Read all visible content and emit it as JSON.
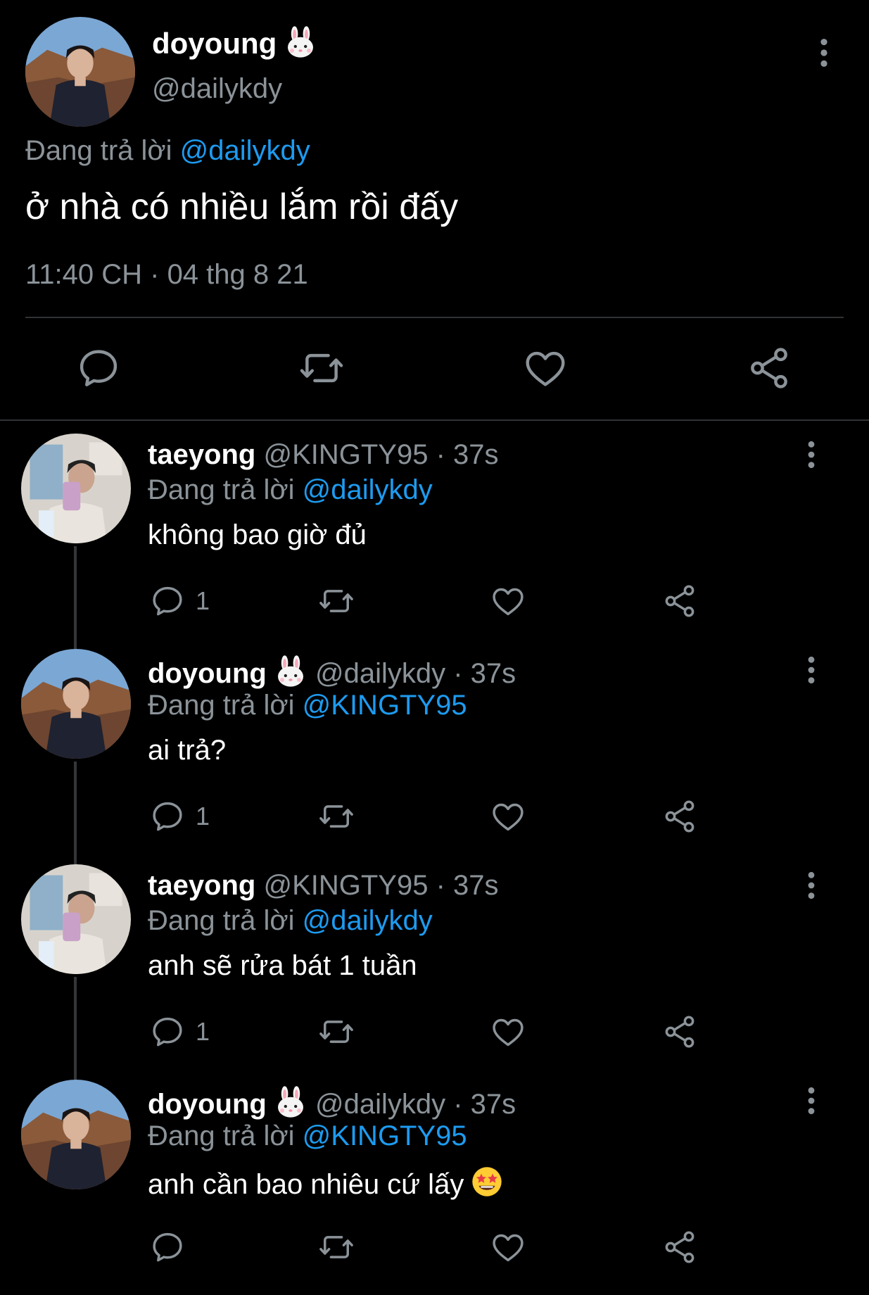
{
  "main_tweet": {
    "name": "doyoung",
    "handle": "@dailykdy",
    "replying_prefix": "Đang trả lời ",
    "replying_to": "@dailykdy",
    "text": "ở nhà có nhiều lắm rồi đấy",
    "timestamp": "11:40 CH · 04 thg 8 21"
  },
  "replies": [
    {
      "name": "taeyong",
      "handle_time": " @KINGTY95 · 37s",
      "replying_prefix": "Đang trả lời ",
      "replying_to": "@dailykdy",
      "text": "không bao giờ đủ",
      "reply_count": "1"
    },
    {
      "name": "doyoung",
      "handle_time": " @dailykdy · 37s",
      "replying_prefix": "Đang trả lời ",
      "replying_to": "@KINGTY95",
      "text": "ai trả?",
      "reply_count": "1"
    },
    {
      "name": "taeyong",
      "handle_time": " @KINGTY95 · 37s",
      "replying_prefix": "Đang trả lời ",
      "replying_to": "@dailykdy",
      "text": "anh sẽ rửa bát 1 tuần",
      "reply_count": "1"
    },
    {
      "name": "doyoung",
      "handle_time": " @dailykdy · 37s",
      "replying_prefix": "Đang trả lời ",
      "replying_to": "@KINGTY95",
      "text": "anh cần bao nhiêu cứ lấy",
      "reply_count": ""
    }
  ],
  "colors": {
    "background": "#000000",
    "text": "#e7e9ea",
    "muted": "#8b9399",
    "link": "#1d9bf0",
    "divider": "#2f3336"
  },
  "icons": [
    "reply-icon",
    "retweet-icon",
    "like-icon",
    "share-icon",
    "more-icon",
    "bunny-emoji",
    "star-struck-emoji"
  ]
}
